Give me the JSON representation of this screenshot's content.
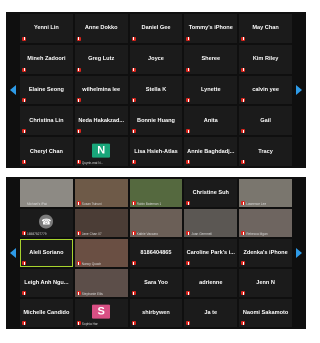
{
  "colors": {
    "accent_blue": "#2e9be8",
    "mute_red": "#d9251d",
    "highlight_green": "#a7d32e",
    "tile_bg": "#1b1b1b"
  },
  "top_panel": {
    "nav_left_icon": "chevron-left-icon",
    "nav_right_icon": "chevron-right-icon",
    "tiles": [
      {
        "name": "Yenni Lin",
        "muted": true
      },
      {
        "name": "Anne Dokko",
        "muted": true
      },
      {
        "name": "Daniel Gee",
        "muted": true
      },
      {
        "name": "Tommy's iPhone",
        "muted": true
      },
      {
        "name": "May Chan",
        "muted": true
      },
      {
        "name": "Mineh Zadoori",
        "muted": true
      },
      {
        "name": "Greg Lutz",
        "muted": true
      },
      {
        "name": "Joyce",
        "muted": true
      },
      {
        "name": "Sheree",
        "muted": true
      },
      {
        "name": "Kim Riley",
        "muted": true
      },
      {
        "name": "Elaine Seong",
        "muted": true
      },
      {
        "name": "wilhelmina lee",
        "muted": true
      },
      {
        "name": "Stella K",
        "muted": true
      },
      {
        "name": "Lynette",
        "muted": true
      },
      {
        "name": "calvin yee",
        "muted": true
      },
      {
        "name": "Christina Lin",
        "muted": true
      },
      {
        "name": "Neda Hakakzad...",
        "muted": true
      },
      {
        "name": "Bonnie Huang",
        "muted": true
      },
      {
        "name": "Anita",
        "muted": true
      },
      {
        "name": "Gail",
        "muted": true
      },
      {
        "name": "Cheryl Chan",
        "muted": true
      },
      {
        "name": "",
        "avatar_letter": "N",
        "avatar_color": "#19a67a",
        "small_label": "Quynh-mai N...",
        "muted": true
      },
      {
        "name": "Lisa Hsieh-Atlas",
        "muted": true
      },
      {
        "name": "Annie Baghdadj...",
        "muted": true
      },
      {
        "name": "Tracy",
        "muted": true
      }
    ]
  },
  "bottom_panel": {
    "nav_left_icon": "chevron-left-icon",
    "nav_right_icon": "chevron-right-icon",
    "tiles": [
      {
        "video": "#8d8a84",
        "small_label": "Michael's iPad",
        "muted": false
      },
      {
        "video": "#6e5a48",
        "small_label": "Susan Tsinuni",
        "muted": true
      },
      {
        "video": "#55693f",
        "small_label": "Robin Bateman 1",
        "muted": true
      },
      {
        "name": "Christine Suh",
        "muted": true
      },
      {
        "video": "#7a766e",
        "small_label": "Lawrence Lee",
        "muted": true
      },
      {
        "phone": true,
        "small_label": "16587527779",
        "muted": true
      },
      {
        "video": "#4b3d36",
        "small_label": "Jane Chan 07",
        "muted": true
      },
      {
        "video": "#6b5f57",
        "small_label": "Kathie Vaccaro",
        "muted": true
      },
      {
        "video": "#5b5753",
        "small_label": "Joan Gemmell",
        "muted": true
      },
      {
        "video": "#6e6560",
        "small_label": "Rebecca Mgan",
        "muted": true
      },
      {
        "name": "Aleli Soriano",
        "muted": true,
        "highlight": true
      },
      {
        "video": "#6a4f43",
        "small_label": "Nancy Quach",
        "muted": true
      },
      {
        "name": "8186404865",
        "muted": true
      },
      {
        "name": "Caroline Park's i...",
        "muted": true
      },
      {
        "name": "Zdenka's iPhone",
        "muted": true
      },
      {
        "name": "Leigh Anh Ngu...",
        "muted": true
      },
      {
        "video": "#5c4e49",
        "small_label": "Stephanie Ellis",
        "muted": true
      },
      {
        "name": "Sara Yoo",
        "muted": true
      },
      {
        "name": "adrienne",
        "muted": true
      },
      {
        "name": "Jenn N",
        "muted": true
      },
      {
        "name": "Michelle Candido",
        "muted": true
      },
      {
        "name": "",
        "avatar_letter": "S",
        "avatar_color": "#d94f84",
        "small_label": "Sophia Har",
        "muted": true
      },
      {
        "name": "shirbywen",
        "muted": true
      },
      {
        "name": "Ja te",
        "muted": true
      },
      {
        "name": "Naomi Sakamoto",
        "muted": true
      }
    ]
  }
}
